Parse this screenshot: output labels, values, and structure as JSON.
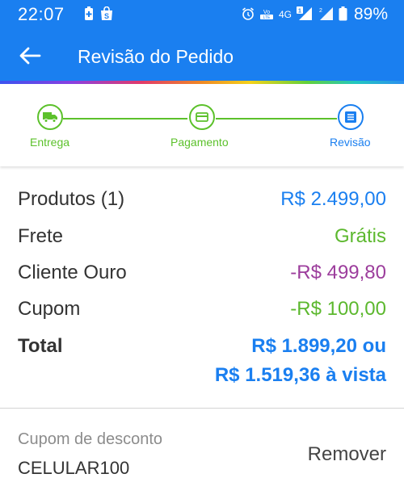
{
  "status_bar": {
    "time": "22:07",
    "battery_percent": "89%",
    "network_label": "4G",
    "icons": [
      "battery-plus-icon",
      "shopping-bag-icon",
      "alarm-icon",
      "volte-icon",
      "4g-icon",
      "signal-1-icon",
      "signal-2-icon",
      "battery-icon"
    ]
  },
  "app_bar": {
    "title": "Revisão do Pedido",
    "back_icon": "arrow-left-icon"
  },
  "stepper": {
    "steps": [
      {
        "label": "Entrega",
        "icon": "truck-icon",
        "state": "completed"
      },
      {
        "label": "Pagamento",
        "icon": "card-icon",
        "state": "completed"
      },
      {
        "label": "Revisão",
        "icon": "list-icon",
        "state": "current"
      }
    ],
    "colors": {
      "completed": "#5cc12b",
      "current": "#1a7ff0"
    }
  },
  "summary": {
    "rows": [
      {
        "label": "Produtos (1)",
        "value": "R$ 2.499,00",
        "color": "#1a7ff0"
      },
      {
        "label": "Frete",
        "value": "Grátis",
        "color": "#5cb82e"
      },
      {
        "label": "Cliente Ouro",
        "value": "-R$ 499,80",
        "color": "#9c3d9c"
      },
      {
        "label": "Cupom",
        "value": "-R$ 100,00",
        "color": "#5cb82e"
      }
    ],
    "total_label": "Total",
    "total_value": "R$ 1.899,20 ou",
    "total_cash": "R$ 1.519,36 à vista"
  },
  "coupon": {
    "label": "Cupom de desconto",
    "code": "CELULAR100",
    "remove_label": "Remover"
  },
  "colors": {
    "primary": "#1a7ff0",
    "success": "#5cc12b"
  }
}
